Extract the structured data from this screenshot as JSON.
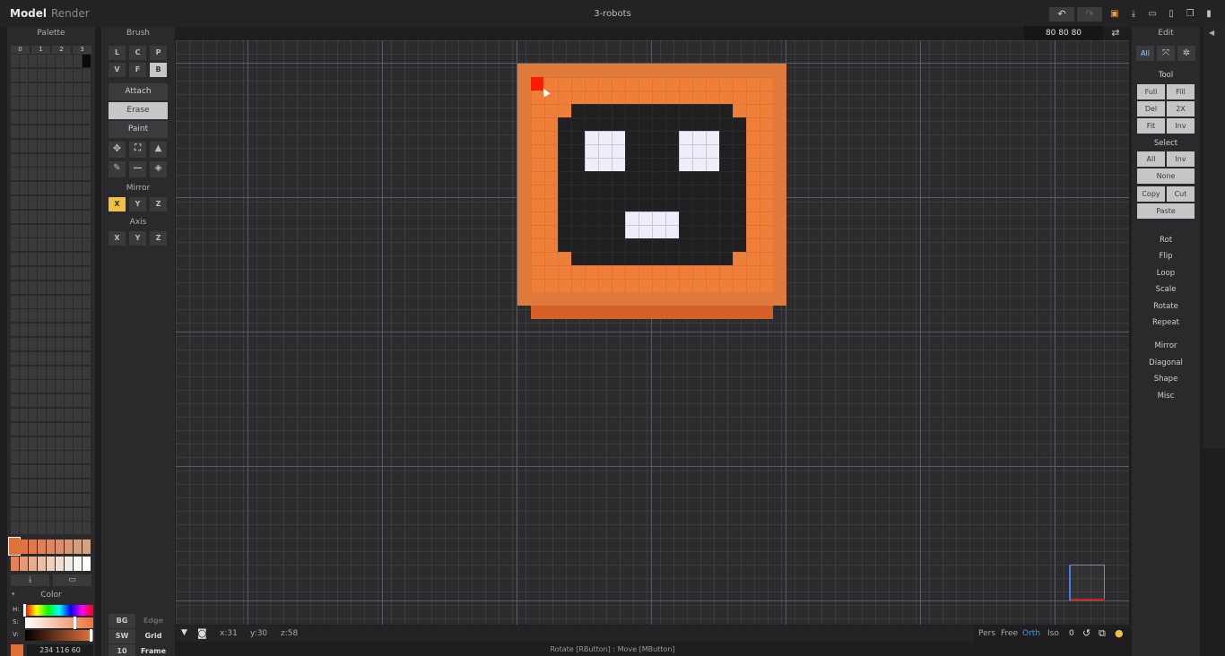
{
  "top_bar": {
    "tabs": [
      "Model",
      "Render"
    ],
    "title": "3-robots",
    "icons": [
      "undo-icon",
      "redo-icon",
      "save-icon",
      "export-icon",
      "open-folder-icon",
      "new-file-icon",
      "copy-file-icon",
      "delete-icon"
    ]
  },
  "palette": {
    "title": "Palette",
    "page_tabs": [
      "0",
      "1",
      "2",
      "3"
    ],
    "orange_row_1": [
      "#e0713a",
      "#df7441",
      "#dd7b4c",
      "#dc8256",
      "#da8960",
      "#d8906a",
      "#d69774",
      "#d59e7e",
      "#d4a385"
    ],
    "orange_row_2": [
      "#e1845a",
      "#e39a77",
      "#e6ad90",
      "#e9bfa7",
      "#ecd0bf",
      "#efdfd3",
      "#f3ece5",
      "#f8f5f2",
      "#ffffff"
    ],
    "selected_color": "#e07038"
  },
  "color": {
    "title": "Color",
    "h_label": "H:",
    "s_label": "S:",
    "v_label": "V:",
    "rgb_readout": "234 116 60"
  },
  "brush": {
    "title": "Brush",
    "row1": [
      "L",
      "C",
      "P"
    ],
    "row2": [
      "V",
      "F",
      "B"
    ],
    "modes": [
      "Attach",
      "Erase",
      "Paint"
    ],
    "tool_icons": [
      "move-icon",
      "select-box-icon",
      "text-cursor-icon",
      "eyedropper-icon",
      "line-icon",
      "fill-bucket-icon"
    ],
    "mirror_title": "Mirror",
    "mirror_buttons": [
      "X",
      "Y",
      "Z"
    ],
    "axis_title": "Axis",
    "axis_buttons": [
      "X",
      "Y",
      "Z"
    ],
    "bottom_left": [
      "BG",
      "SW",
      "10"
    ],
    "bottom_right": [
      "Edge",
      "Grid",
      "Frame"
    ]
  },
  "dimension_readout": "80 80 80",
  "edit": {
    "title": "Edit",
    "filter_labels": [
      "All"
    ],
    "tool_title": "Tool",
    "tool_buttons": [
      "Full",
      "Fill",
      "Del",
      "2X",
      "Fit",
      "Inv"
    ],
    "select_title": "Select",
    "select_buttons": [
      "All",
      "Inv",
      "None",
      "Copy",
      "Cut",
      "Paste"
    ],
    "ops": [
      "Rot",
      "Flip",
      "Loop",
      "Scale",
      "Rotate",
      "Repeat"
    ],
    "ops2": [
      "Mirror",
      "Diagonal",
      "Shape",
      "Misc"
    ]
  },
  "status": {
    "x": "x:31",
    "y": "y:30",
    "z": "z:58",
    "views": [
      "Pers",
      "Free",
      "Orth",
      "Iso"
    ],
    "active_view": "Orth",
    "zero": "0",
    "hint": "Rotate [RButton] : Move [MButton]"
  },
  "colors": {
    "accent_orange": "#e07038",
    "mirror_active": "#f0c040",
    "face_black": "#202022",
    "eye_white": "#eeeef8",
    "marker_red": "#ff1a00",
    "active_blue": "#4a9be8"
  }
}
